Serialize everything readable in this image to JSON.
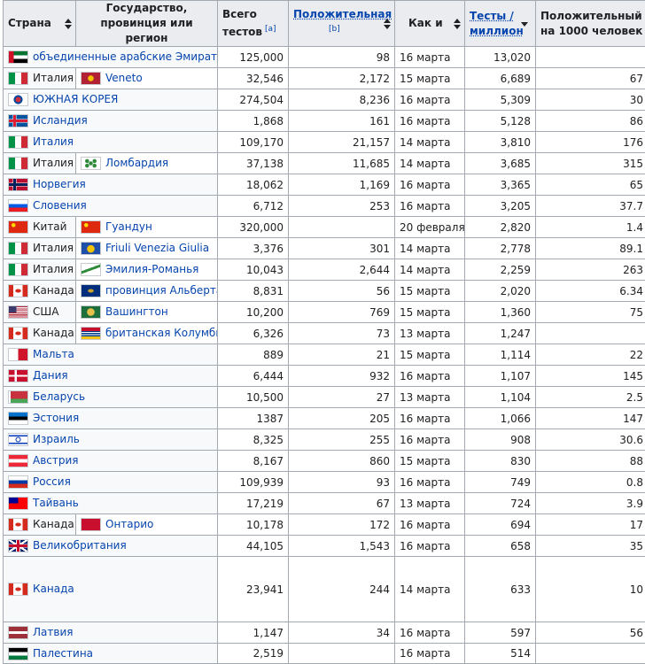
{
  "headers": {
    "country": "Страна",
    "region": "Государство, провинция или регион",
    "total": "Всего тестов",
    "total_ref": "[a]",
    "positive": "Положительная",
    "positive_ref": "[b]",
    "as_of": "Как и",
    "per_million": "Тесты / миллион",
    "per_thousand": "Положительный на 1000 человек"
  },
  "rows": [
    {
      "flag": "uae-flag",
      "country": "объединенные арабские Эмираты",
      "region_flag": "",
      "region": "",
      "total": "125,000",
      "positive": "98",
      "date": "16 марта",
      "tpm": "13,020",
      "ppk": ""
    },
    {
      "flag": "italy-flag",
      "country": "Италия",
      "region_flag": "veneto-flag",
      "region": "Veneto",
      "total": "32,546",
      "positive": "2,172",
      "date": "15 марта",
      "tpm": "6,689",
      "ppk": "67"
    },
    {
      "flag": "south-korea-flag",
      "country": "ЮЖНАЯ КОРЕЯ",
      "region_flag": "",
      "region": "",
      "total": "274,504",
      "positive": "8,236",
      "date": "16 марта",
      "tpm": "5,309",
      "ppk": "30"
    },
    {
      "flag": "iceland-flag",
      "country": "Исландия",
      "region_flag": "",
      "region": "",
      "total": "1,868",
      "positive": "161",
      "date": "16 марта",
      "tpm": "5,128",
      "ppk": "86"
    },
    {
      "flag": "italy-flag",
      "country": "Италия",
      "region_flag": "",
      "region": "",
      "total": "109,170",
      "positive": "21,157",
      "date": "14 марта",
      "tpm": "3,810",
      "ppk": "176"
    },
    {
      "flag": "italy-flag",
      "country": "Италия",
      "region_flag": "lombardy-flag",
      "region": "Ломбардия",
      "total": "37,138",
      "positive": "11,685",
      "date": "14 марта",
      "tpm": "3,685",
      "ppk": "315"
    },
    {
      "flag": "norway-flag",
      "country": "Норвегия",
      "region_flag": "",
      "region": "",
      "total": "18,062",
      "positive": "1,169",
      "date": "16 марта",
      "tpm": "3,365",
      "ppk": "65"
    },
    {
      "flag": "slovenia-flag",
      "country": "Словения",
      "region_flag": "",
      "region": "",
      "total": "6,712",
      "positive": "253",
      "date": "16 марта",
      "tpm": "3,205",
      "ppk": "37.7"
    },
    {
      "flag": "china-flag",
      "country": "Китай",
      "region_flag": "china-flag",
      "region": "Гуандун",
      "total": "320,000",
      "positive": "",
      "date": "20 февраля",
      "tpm": "2,820",
      "ppk": "1.4"
    },
    {
      "flag": "italy-flag",
      "country": "Италия",
      "region_flag": "friuli-flag",
      "region": "Friuli Venezia Giulia",
      "total": "3,376",
      "positive": "301",
      "date": "14 марта",
      "tpm": "2,778",
      "ppk": "89.1"
    },
    {
      "flag": "italy-flag",
      "country": "Италия",
      "region_flag": "emilia-flag",
      "region": "Эмилия-Романья",
      "total": "10,043",
      "positive": "2,644",
      "date": "14 марта",
      "tpm": "2,259",
      "ppk": "263"
    },
    {
      "flag": "canada-flag",
      "country": "Канада",
      "region_flag": "alberta-flag",
      "region": "провинция Альберта",
      "total": "8,831",
      "positive": "56",
      "date": "15 марта",
      "tpm": "2,020",
      "ppk": "6.34"
    },
    {
      "flag": "usa-flag",
      "country": "США",
      "region_flag": "washington-flag",
      "region": "Вашингтон",
      "total": "10,200",
      "positive": "769",
      "date": "15 марта",
      "tpm": "1,360",
      "ppk": "75"
    },
    {
      "flag": "canada-flag",
      "country": "Канада",
      "region_flag": "bc-flag",
      "region": "британская Колумбия",
      "total": "6,326",
      "positive": "73",
      "date": "13 марта",
      "tpm": "1,247",
      "ppk": ""
    },
    {
      "flag": "malta-flag",
      "country": "Мальта",
      "region_flag": "",
      "region": "",
      "total": "889",
      "positive": "21",
      "date": "15 марта",
      "tpm": "1,114",
      "ppk": "22"
    },
    {
      "flag": "denmark-flag",
      "country": "Дания",
      "region_flag": "",
      "region": "",
      "total": "6,444",
      "positive": "932",
      "date": "16 марта",
      "tpm": "1,107",
      "ppk": "145"
    },
    {
      "flag": "belarus-flag",
      "country": "Беларусь",
      "region_flag": "",
      "region": "",
      "total": "10,500",
      "positive": "27",
      "date": "13 марта",
      "tpm": "1,104",
      "ppk": "2.5"
    },
    {
      "flag": "estonia-flag",
      "country": "Эстония",
      "region_flag": "",
      "region": "",
      "total": "1387",
      "positive": "205",
      "date": "16 марта",
      "tpm": "1,066",
      "ppk": "147"
    },
    {
      "flag": "israel-flag",
      "country": "Израиль",
      "region_flag": "",
      "region": "",
      "total": "8,325",
      "positive": "255",
      "date": "16 марта",
      "tpm": "908",
      "ppk": "30.6"
    },
    {
      "flag": "austria-flag",
      "country": "Австрия",
      "region_flag": "",
      "region": "",
      "total": "8,167",
      "positive": "860",
      "date": "15 марта",
      "tpm": "830",
      "ppk": "88"
    },
    {
      "flag": "russia-flag",
      "country": "Россия",
      "region_flag": "",
      "region": "",
      "total": "109,939",
      "positive": "93",
      "date": "16 марта",
      "tpm": "749",
      "ppk": "0.8"
    },
    {
      "flag": "taiwan-flag",
      "country": "Тайвань",
      "region_flag": "",
      "region": "",
      "total": "17,219",
      "positive": "67",
      "date": "13 марта",
      "tpm": "724",
      "ppk": "3.9"
    },
    {
      "flag": "canada-flag",
      "country": "Канада",
      "region_flag": "ontario-flag",
      "region": "Онтарио",
      "total": "10,178",
      "positive": "172",
      "date": "16 марта",
      "tpm": "694",
      "ppk": "17"
    },
    {
      "flag": "uk-flag",
      "country": "Великобритания",
      "region_flag": "",
      "region": "",
      "total": "44,105",
      "positive": "1,543",
      "date": "16 марта",
      "tpm": "658",
      "ppk": "35"
    },
    {
      "flag": "canada-flag",
      "country": "Канада",
      "region_flag": "",
      "region": "",
      "total": "23,941",
      "positive": "244",
      "date": "14 марта",
      "tpm": "633",
      "ppk": "10"
    },
    {
      "flag": "latvia-flag",
      "country": "Латвия",
      "region_flag": "",
      "region": "",
      "total": "1,147",
      "positive": "34",
      "date": "16 марта",
      "tpm": "597",
      "ppk": "56"
    },
    {
      "flag": "palestine-flag",
      "country": "Палестина",
      "region_flag": "",
      "region": "",
      "total": "2,519",
      "positive": "",
      "date": "16 марта",
      "tpm": "514",
      "ppk": ""
    }
  ]
}
